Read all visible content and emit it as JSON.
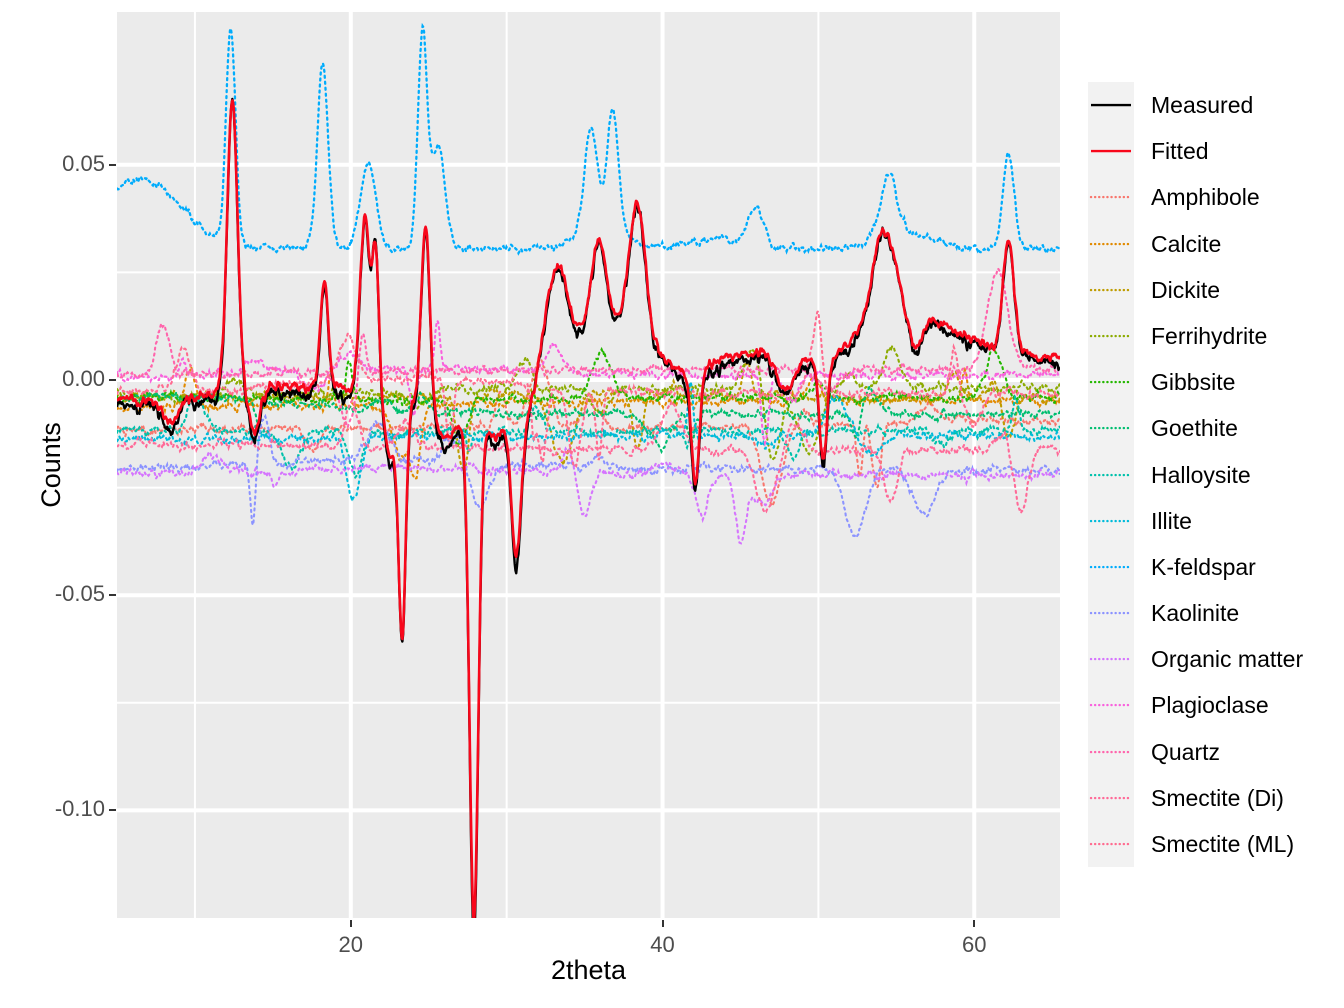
{
  "chart_data": {
    "type": "line",
    "title": "",
    "xlabel": "2theta",
    "ylabel": "Counts",
    "xlim": [
      5,
      65.5
    ],
    "ylim": [
      -0.125,
      0.0855
    ],
    "xticks": [
      20,
      40,
      60
    ],
    "xtick_labels": [
      "20",
      "40",
      "60"
    ],
    "x_minor_ticks": [
      10,
      30,
      50
    ],
    "yticks": [
      0.05,
      0.0,
      -0.05,
      -0.1
    ],
    "ytick_labels": [
      "0.05",
      "0.00",
      "-0.05",
      "-0.10"
    ],
    "y_minor_ticks": [
      0.025,
      -0.025,
      -0.075
    ],
    "grid": true,
    "legend_position": "right",
    "panel_background": "#ebebeb",
    "grid_color": "#ffffff",
    "series": [
      {
        "name": "Measured",
        "color": "#000000",
        "linetype": "solid",
        "baseline": 0.0,
        "role": "observed",
        "seed": 11
      },
      {
        "name": "Fitted",
        "color": "#f8071b",
        "linetype": "solid",
        "baseline": 0.0,
        "role": "model",
        "seed": 12
      },
      {
        "name": "Amphibole",
        "color": "#f8766d",
        "linetype": "dotted",
        "baseline": -0.0115,
        "role": "component",
        "seed": 1
      },
      {
        "name": "Calcite",
        "color": "#e18a00",
        "linetype": "dotted",
        "baseline": -0.0063,
        "role": "component",
        "seed": 2
      },
      {
        "name": "Dickite",
        "color": "#be9c00",
        "linetype": "dotted",
        "baseline": -0.0038,
        "role": "component",
        "seed": 3
      },
      {
        "name": "Ferrihydrite",
        "color": "#8cab00",
        "linetype": "dotted",
        "baseline": -0.0021,
        "role": "component",
        "seed": 4
      },
      {
        "name": "Gibbsite",
        "color": "#24b700",
        "linetype": "dotted",
        "baseline": -0.005,
        "role": "component",
        "seed": 5
      },
      {
        "name": "Goethite",
        "color": "#00be70",
        "linetype": "dotted",
        "baseline": -0.0072,
        "role": "component",
        "seed": 6
      },
      {
        "name": "Halloysite",
        "color": "#00c1ab",
        "linetype": "dotted",
        "baseline": -0.0118,
        "role": "component",
        "seed": 7
      },
      {
        "name": "Illite",
        "color": "#00bbda",
        "linetype": "dotted",
        "baseline": -0.0135,
        "role": "component",
        "seed": 8
      },
      {
        "name": "K-feldspar",
        "color": "#00acfc",
        "linetype": "dotted",
        "baseline": 0.0305,
        "role": "component-offset",
        "seed": 9
      },
      {
        "name": "Kaolinite",
        "color": "#8b93ff",
        "linetype": "dotted",
        "baseline": -0.0205,
        "role": "component",
        "seed": 10
      },
      {
        "name": "Organic matter",
        "color": "#d575fe",
        "linetype": "dotted",
        "baseline": -0.0215,
        "role": "component",
        "seed": 13
      },
      {
        "name": "Plagioclase",
        "color": "#f962dd",
        "linetype": "dotted",
        "baseline": 0.001,
        "role": "component",
        "seed": 14
      },
      {
        "name": "Quartz",
        "color": "#ff65ac",
        "linetype": "dotted",
        "baseline": 0.0016,
        "role": "component",
        "seed": 15
      },
      {
        "name": "Smectite (Di)",
        "color": "#ff6a98",
        "linetype": "dotted",
        "baseline": -0.015,
        "role": "component",
        "seed": 16
      },
      {
        "name": "Smectite (ML)",
        "color": "#ff6c90",
        "linetype": "dotted",
        "baseline": -0.003,
        "role": "component",
        "seed": 17
      }
    ],
    "observed_peaks": [
      {
        "x": 12.4,
        "height": 0.069,
        "width": 0.33
      },
      {
        "x": 18.3,
        "height": 0.025,
        "width": 0.25
      },
      {
        "x": 20.9,
        "height": 0.0395,
        "width": 0.3
      },
      {
        "x": 21.6,
        "height": 0.033,
        "width": 0.22
      },
      {
        "x": 24.8,
        "height": 0.0455,
        "width": 0.28
      },
      {
        "x": 33.2,
        "height": 0.02,
        "width": 0.6
      },
      {
        "x": 35.9,
        "height": 0.0205,
        "width": 0.45
      },
      {
        "x": 38.4,
        "height": 0.031,
        "width": 0.5
      },
      {
        "x": 54.2,
        "height": 0.0212,
        "width": 0.7
      },
      {
        "x": 62.2,
        "height": 0.0262,
        "width": 0.35
      }
    ],
    "observed_troughs": [
      {
        "x": 23.3,
        "depth": -0.052,
        "width": 0.22
      },
      {
        "x": 27.9,
        "depth": -0.118,
        "width": 0.28
      },
      {
        "x": 30.6,
        "depth": -0.033,
        "width": 0.3
      },
      {
        "x": 42.1,
        "depth": -0.0268,
        "width": 0.25
      },
      {
        "x": 50.3,
        "depth": -0.0245,
        "width": 0.25
      }
    ],
    "kfeldspar_peaks": [
      {
        "x": 12.3,
        "height": 0.05,
        "width": 0.3
      },
      {
        "x": 18.2,
        "height": 0.043,
        "width": 0.35
      },
      {
        "x": 21.1,
        "height": 0.02,
        "width": 0.5
      },
      {
        "x": 24.6,
        "height": 0.049,
        "width": 0.3
      },
      {
        "x": 25.6,
        "height": 0.0235,
        "width": 0.45
      },
      {
        "x": 35.4,
        "height": 0.023,
        "width": 0.4
      },
      {
        "x": 36.8,
        "height": 0.027,
        "width": 0.35
      },
      {
        "x": 46.0,
        "height": 0.0085,
        "width": 0.45
      },
      {
        "x": 54.5,
        "height": 0.014,
        "width": 0.5
      },
      {
        "x": 62.2,
        "height": 0.022,
        "width": 0.35
      }
    ]
  },
  "axes": {
    "ylabel": "Counts",
    "xlabel": "2theta",
    "ytick_labels": [
      "0.05",
      "0.00",
      "-0.05",
      "-0.10"
    ],
    "xtick_labels": [
      "20",
      "40",
      "60"
    ]
  },
  "legend": {
    "items": [
      {
        "label": "Measured"
      },
      {
        "label": "Fitted"
      },
      {
        "label": "Amphibole"
      },
      {
        "label": "Calcite"
      },
      {
        "label": "Dickite"
      },
      {
        "label": "Ferrihydrite"
      },
      {
        "label": "Gibbsite"
      },
      {
        "label": "Goethite"
      },
      {
        "label": "Halloysite"
      },
      {
        "label": "Illite"
      },
      {
        "label": "K-feldspar"
      },
      {
        "label": "Kaolinite"
      },
      {
        "label": "Organic matter"
      },
      {
        "label": "Plagioclase"
      },
      {
        "label": "Quartz"
      },
      {
        "label": "Smectite (Di)"
      },
      {
        "label": "Smectite (ML)"
      }
    ]
  }
}
